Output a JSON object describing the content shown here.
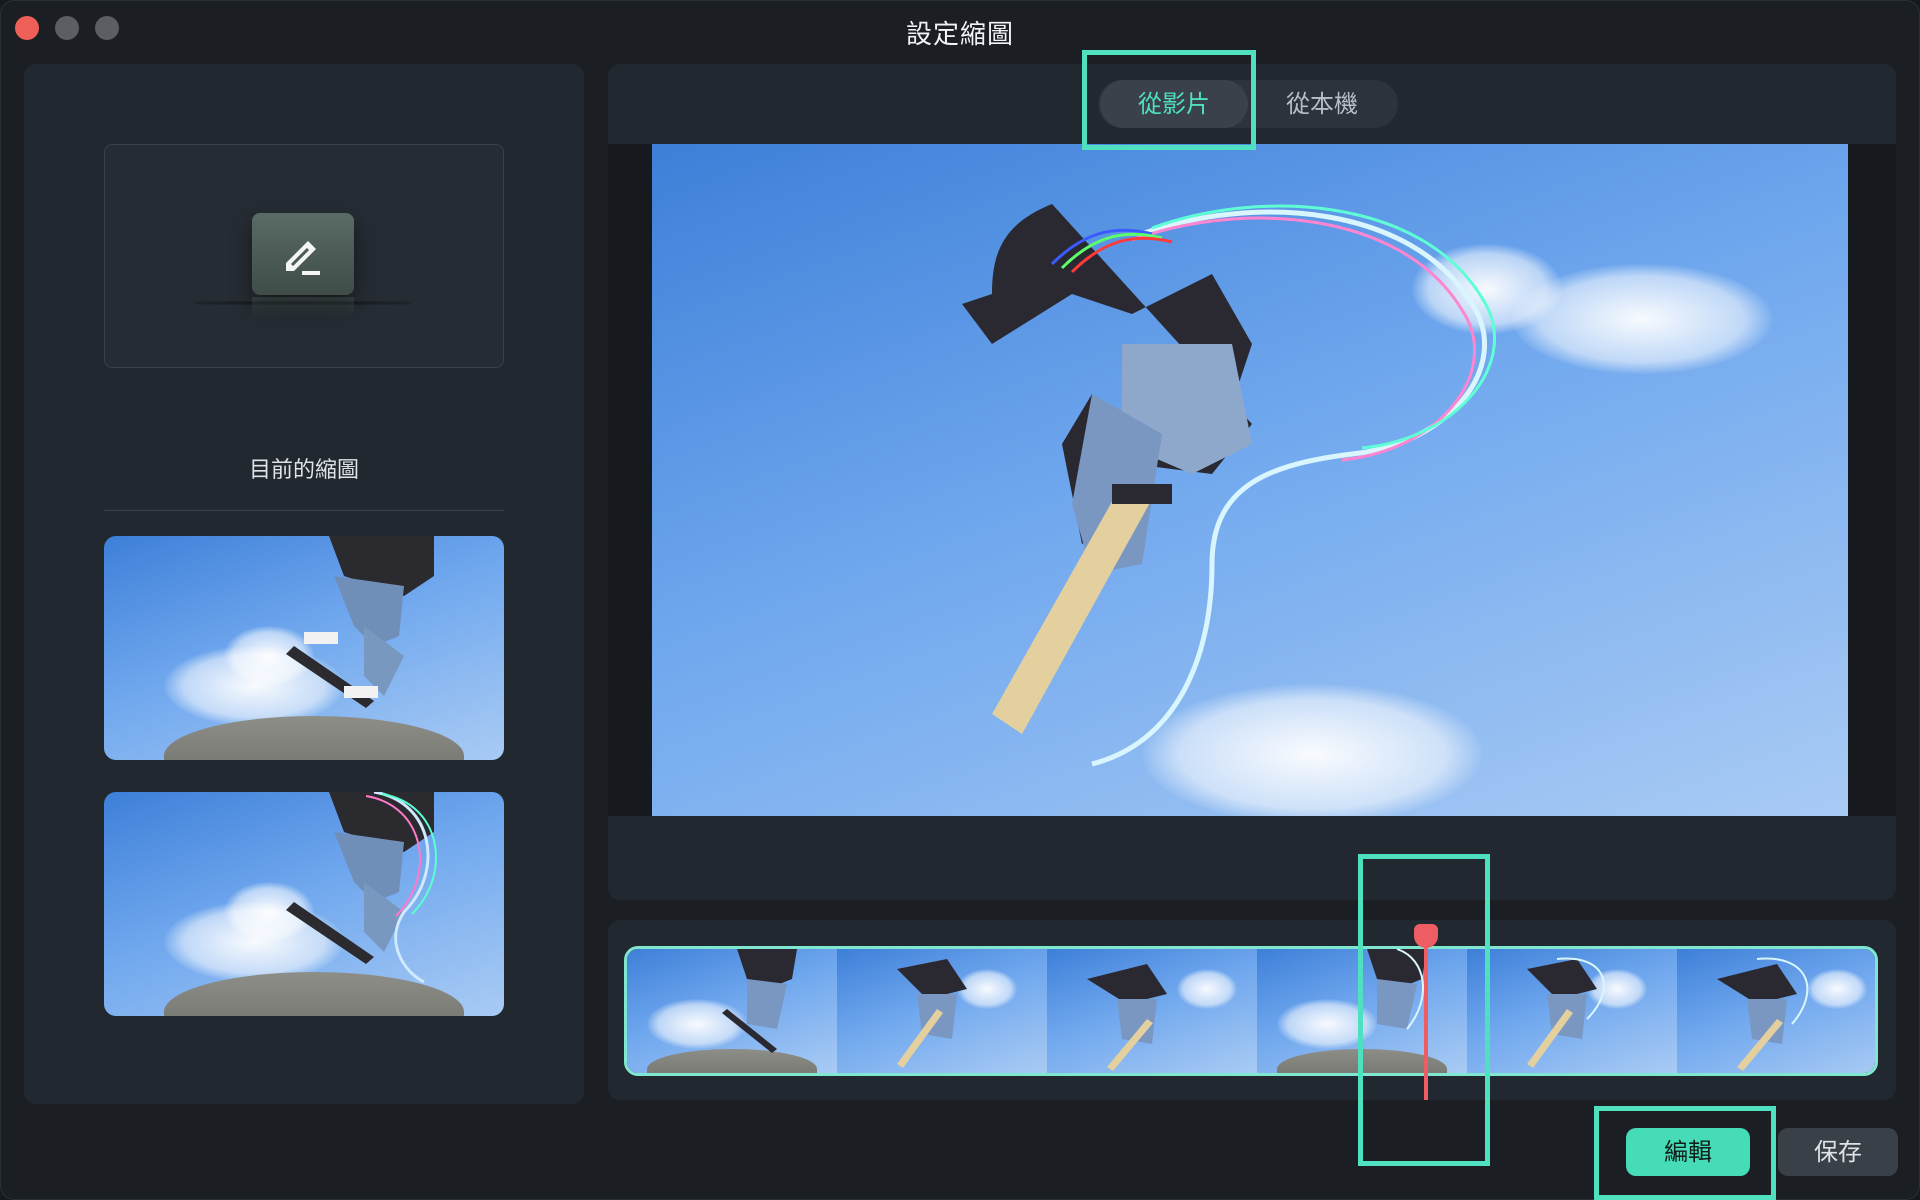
{
  "window": {
    "title": "設定縮圖"
  },
  "left_panel": {
    "current_thumbnail_label": "目前的縮圖",
    "edit_icon": "pencil-icon"
  },
  "right_panel": {
    "tabs": [
      {
        "label": "從影片",
        "selected": true
      },
      {
        "label": "從本機",
        "selected": false
      }
    ]
  },
  "buttons": {
    "edit_label": "編輯",
    "save_label": "保存"
  },
  "colors": {
    "accent": "#4fe0c0",
    "playhead": "#ef5d64",
    "close": "#ee5f57"
  }
}
